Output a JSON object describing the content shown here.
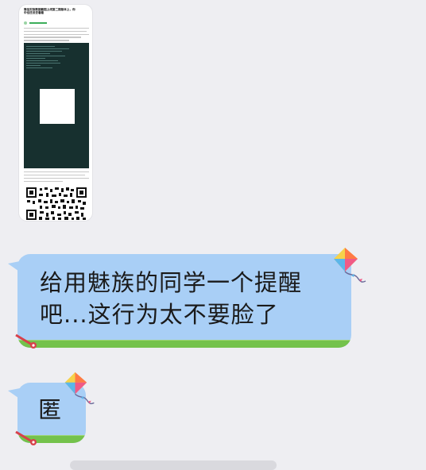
{
  "shared_image": {
    "article_title": "微信实际数据截图上线第二期版本上，你\n中也还没去看看",
    "account_name": "公众号名称"
  },
  "messages": [
    {
      "text": "给用魅族的同学一个提醒吧...这行为太不要脸了"
    },
    {
      "text": "匿"
    }
  ],
  "colors": {
    "bubble": "#a9cff6",
    "grass": "#74c24c",
    "background": "#eeeef2"
  },
  "icons": [
    "kite-icon",
    "pin-icon",
    "qr-code-icon"
  ]
}
